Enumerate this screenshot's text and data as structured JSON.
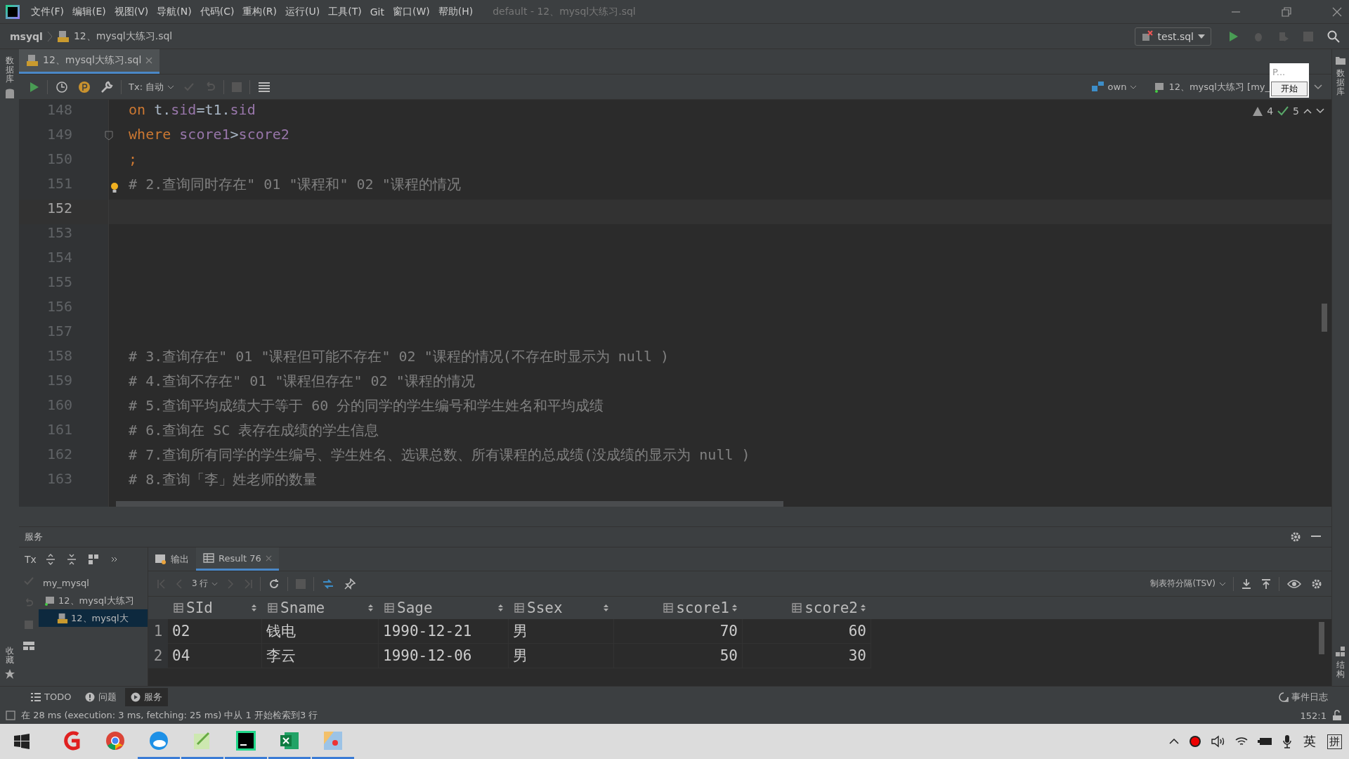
{
  "window": {
    "title": "default - 12、mysql大练习.sql"
  },
  "menu": [
    "文件(F)",
    "编辑(E)",
    "视图(V)",
    "导航(N)",
    "代码(C)",
    "重构(R)",
    "运行(U)",
    "工具(T)",
    "Git",
    "窗口(W)",
    "帮助(H)"
  ],
  "breadcrumb": [
    "msyql",
    "12、mysql大练习.sql"
  ],
  "run_config": "test.sql",
  "side_tools": {
    "left_top": "数据库",
    "left_bottom": "收藏",
    "right_top": "数据库",
    "right_bottom": "结构"
  },
  "editor_tabs": [
    {
      "label": "12、mysql大练习.sql",
      "selected": true
    }
  ],
  "editor_toolbar": {
    "tx": "Tx: 自动",
    "schema": "own",
    "datasource": "12、mysql大练习 [my_"
  },
  "popup": {
    "field": "P...",
    "button": "开始"
  },
  "inspections": {
    "warnings": "4",
    "ok": "5"
  },
  "code": [
    {
      "number": "148",
      "current": false,
      "tokens": [
        {
          "kind": "keyword",
          "text": "on"
        },
        {
          "kind": "plain",
          "text": " t."
        },
        {
          "kind": "ident",
          "text": "sid"
        },
        {
          "kind": "plain",
          "text": "=t1."
        },
        {
          "kind": "ident",
          "text": "sid"
        }
      ]
    },
    {
      "number": "149",
      "current": false,
      "fold": true,
      "tokens": [
        {
          "kind": "keyword",
          "text": "where "
        },
        {
          "kind": "ident",
          "text": "score1"
        },
        {
          "kind": "plain",
          "text": ">"
        },
        {
          "kind": "ident",
          "text": "score2"
        }
      ]
    },
    {
      "number": "150",
      "current": false,
      "tokens": [
        {
          "kind": "keyword",
          "text": ";"
        }
      ]
    },
    {
      "number": "151",
      "current": false,
      "bulb": true,
      "tokens": [
        {
          "kind": "comment",
          "text": "# 2.查询同时存在\" 01 \"课程和\" 02 \"课程的情况"
        }
      ]
    },
    {
      "number": "152",
      "current": true
    },
    {
      "number": "153",
      "current": false
    },
    {
      "number": "154",
      "current": false
    },
    {
      "number": "155",
      "current": false
    },
    {
      "number": "156",
      "current": false
    },
    {
      "number": "157",
      "current": false
    },
    {
      "number": "158",
      "current": false,
      "tokens": [
        {
          "kind": "comment",
          "text": "# 3.查询存在\" 01 \"课程但可能不存在\" 02 \"课程的情况(不存在时显示为 null )"
        }
      ]
    },
    {
      "number": "159",
      "current": false,
      "tokens": [
        {
          "kind": "comment",
          "text": "# 4.查询不存在\" 01 \"课程但存在\" 02 \"课程的情况"
        }
      ]
    },
    {
      "number": "160",
      "current": false,
      "tokens": [
        {
          "kind": "comment",
          "text": "# 5.查询平均成绩大于等于 60 分的同学的学生编号和学生姓名和平均成绩"
        }
      ]
    },
    {
      "number": "161",
      "current": false,
      "tokens": [
        {
          "kind": "comment",
          "text": "# 6.查询在 SC 表存在成绩的学生信息"
        }
      ]
    },
    {
      "number": "162",
      "current": false,
      "tokens": [
        {
          "kind": "comment",
          "text": "# 7.查询所有同学的学生编号、学生姓名、选课总数、所有课程的总成绩(没成绩的显示为 null )"
        }
      ]
    },
    {
      "number": "163",
      "current": false,
      "tokens": [
        {
          "kind": "comment",
          "text": "# 8.查询「李」姓老师的数量"
        }
      ]
    }
  ],
  "services": {
    "title": "服务",
    "tx": "Tx",
    "tree": [
      {
        "label": "my_mysql",
        "selected": false,
        "children": [
          {
            "label": "12、mysql大练习",
            "kind": "datasource",
            "selected": false,
            "children": [
              {
                "label": "12、mysql大",
                "kind": "file",
                "selected": true
              }
            ]
          }
        ]
      }
    ]
  },
  "result_tabs": [
    {
      "label": "输出",
      "selected": false
    },
    {
      "label": "Result 76",
      "selected": true
    }
  ],
  "result": {
    "rows_selector": "3 行",
    "format": "制表符分隔(TSV)",
    "columns": [
      {
        "name": "SId",
        "numeric": false
      },
      {
        "name": "Sname",
        "numeric": false
      },
      {
        "name": "Sage",
        "numeric": false
      },
      {
        "name": "Ssex",
        "numeric": false
      },
      {
        "name": "score1",
        "numeric": true
      },
      {
        "name": "score2",
        "numeric": true
      }
    ],
    "rows": [
      {
        "number": "1",
        "cells": [
          "02",
          "钱电",
          "1990-12-21",
          "男",
          "70",
          "60"
        ]
      },
      {
        "number": "2",
        "cells": [
          "04",
          "李云",
          "1990-12-06",
          "男",
          "50",
          "30"
        ]
      }
    ]
  },
  "tool_tabs": [
    {
      "label": "TODO",
      "kind": "list",
      "selected": false
    },
    {
      "label": "问题",
      "kind": "info",
      "selected": false
    },
    {
      "label": "服务",
      "kind": "play",
      "selected": true
    }
  ],
  "event_log": "事件日志",
  "status": {
    "message": "在 28 ms (execution: 3 ms, fetching: 25 ms) 中从 1 开始检索到3 行",
    "position": "152:1"
  },
  "taskbar": {
    "apps": [
      {
        "kind": "letter",
        "running": false
      },
      {
        "kind": "globe",
        "running": false
      },
      {
        "kind": "cloud",
        "running": true
      },
      {
        "kind": "notepad",
        "running": true
      },
      {
        "kind": "dg",
        "running": true
      },
      {
        "kind": "sheet",
        "running": true
      },
      {
        "kind": "paint",
        "running": true
      }
    ],
    "ime": "英",
    "ime_mode": "拼"
  }
}
